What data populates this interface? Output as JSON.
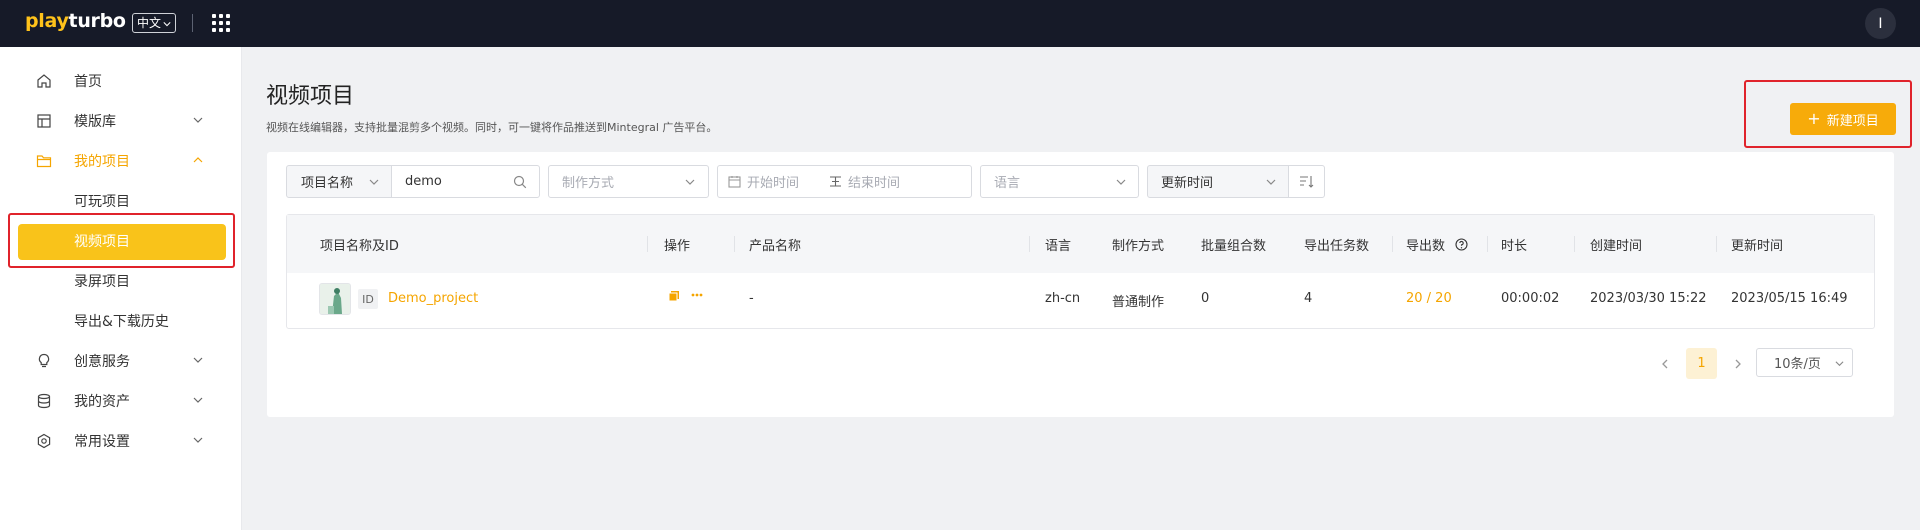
{
  "header": {
    "logo_play": "play",
    "logo_turbo": "turbo",
    "language": "中文",
    "avatar_initial": "I"
  },
  "sidebar": {
    "items": [
      {
        "label": "首页",
        "icon": "home-icon"
      },
      {
        "label": "模版库",
        "icon": "template-icon"
      },
      {
        "label": "我的项目",
        "icon": "folder-icon"
      },
      {
        "label": "可玩项目"
      },
      {
        "label": "视频项目"
      },
      {
        "label": "录屏项目"
      },
      {
        "label": "导出&下载历史"
      },
      {
        "label": "创意服务",
        "icon": "bulb-icon"
      },
      {
        "label": "我的资产",
        "icon": "database-icon"
      },
      {
        "label": "常用设置",
        "icon": "settings-icon"
      }
    ]
  },
  "main": {
    "title": "视频项目",
    "description": "视频在线编辑器，支持批量混剪多个视频。同时，可一键将作品推送到Mintegral 广告平台。",
    "new_button": "新建项目"
  },
  "filters": {
    "name_field_select": "项目名称",
    "name_field_value": "demo",
    "method_placeholder": "制作方式",
    "start_placeholder": "开始时间",
    "end_placeholder": "结束时间",
    "language_placeholder": "语言",
    "sort_field": "更新时间"
  },
  "table": {
    "columns": [
      "项目名称及ID",
      "操作",
      "产品名称",
      "语言",
      "制作方式",
      "批量组合数",
      "导出任务数",
      "导出数",
      "时长",
      "创建时间",
      "更新时间"
    ],
    "rows": [
      {
        "id_tag": "ID",
        "name": "Demo_project",
        "product": "-",
        "language": "zh-cn",
        "method": "普通制作",
        "batch_count": "0",
        "export_tasks": "4",
        "exports": "20 / 20",
        "duration": "00:00:02",
        "created": "2023/03/30 15:22",
        "updated": "2023/05/15 16:49"
      }
    ]
  },
  "pagination": {
    "current": "1",
    "page_size": "10条/页"
  },
  "colors": {
    "accent": "#f7ab0a",
    "selected_nav": "#f9c31a",
    "header_bg": "#161a28",
    "highlight_box": "#e0232b"
  }
}
